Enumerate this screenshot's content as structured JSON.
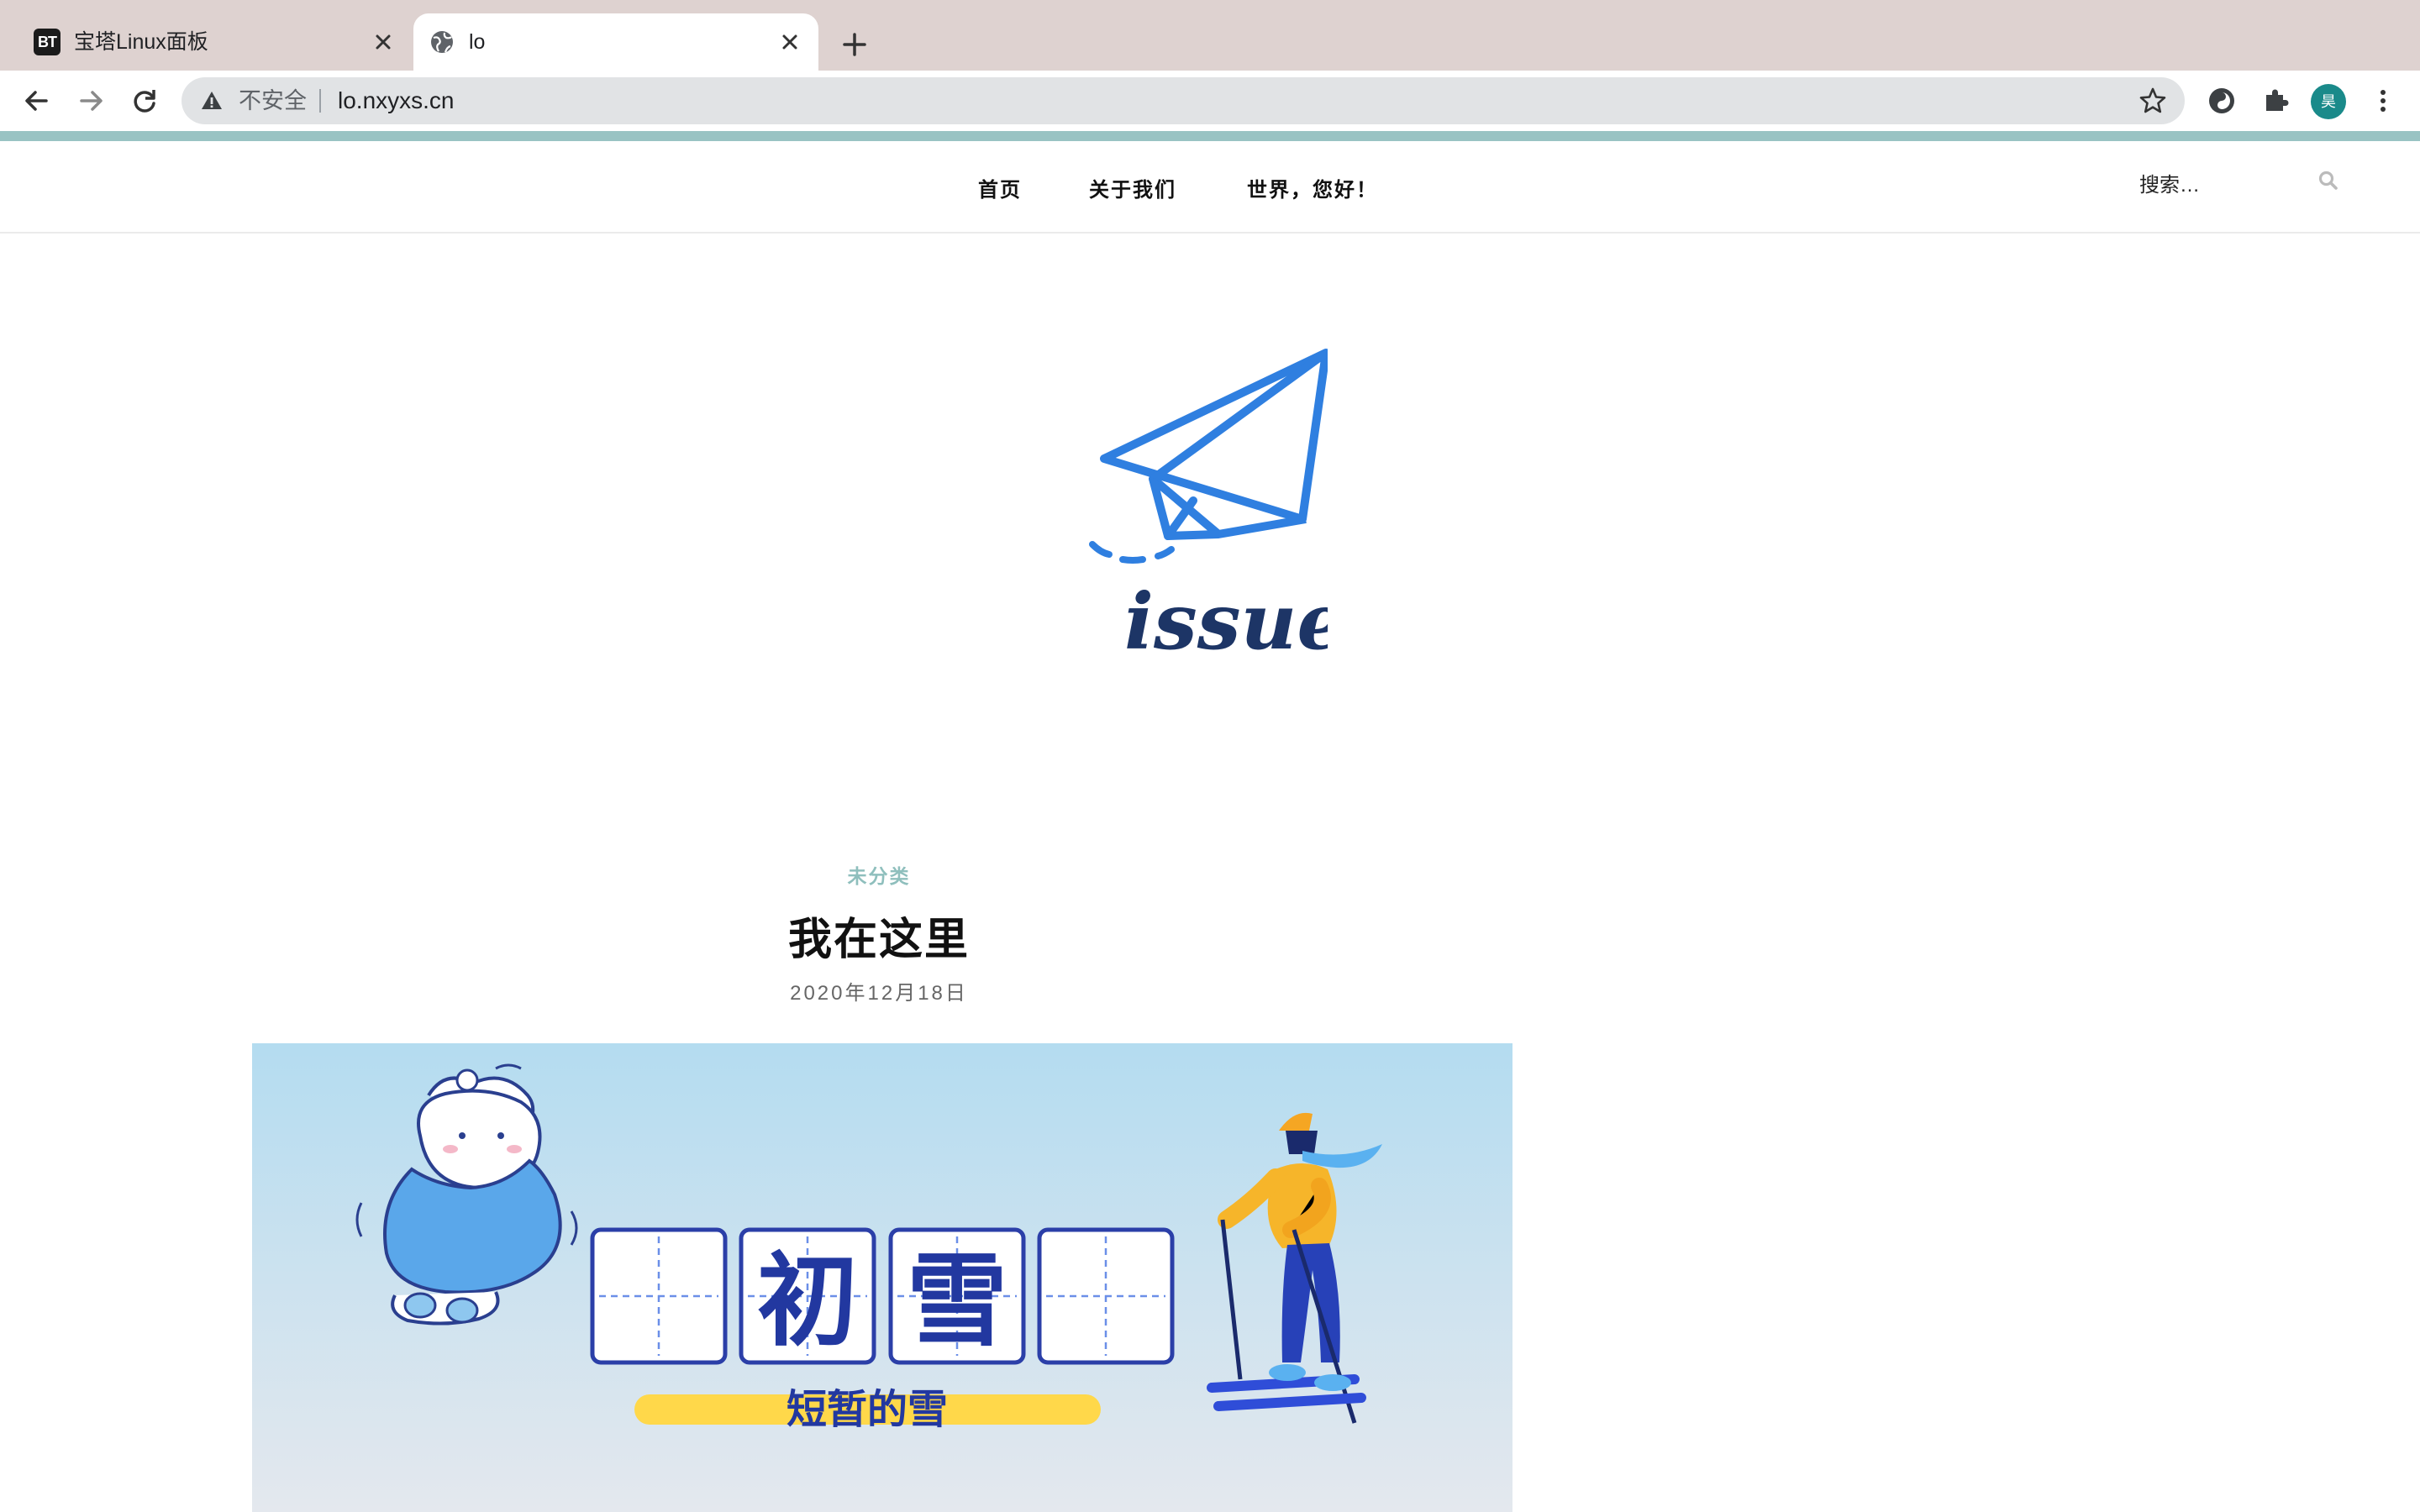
{
  "browser": {
    "tabs": [
      {
        "title": "宝塔Linux面板",
        "favicon": "BT",
        "active": false
      },
      {
        "title": "lo",
        "favicon": "globe-icon",
        "active": true
      }
    ],
    "address": {
      "security_label": "不安全",
      "url": "lo.nxyxs.cn"
    },
    "profile_initial": "昊"
  },
  "site": {
    "menu": [
      "首页",
      "关于我们",
      "世界，您好！"
    ],
    "search_placeholder": "搜索…",
    "logo_text": "issue"
  },
  "post": {
    "category": "未分类",
    "title": "我在这里",
    "date": "2020年12月18日",
    "image": {
      "box_chars": [
        "初",
        "雪"
      ],
      "banner_text": "短暂的雪"
    }
  },
  "colors": {
    "accent": "#99c3c3",
    "category": "#8fbfbd",
    "logo_blue": "#2f7fe0",
    "logo_navy": "#1d3566"
  }
}
